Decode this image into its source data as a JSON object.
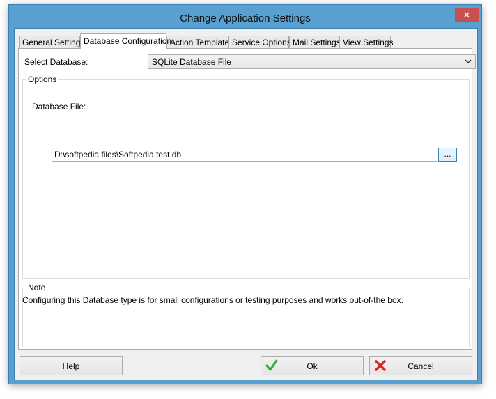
{
  "window": {
    "title": "Change Application Settings",
    "close_glyph": "✕"
  },
  "tabs": [
    {
      "label": "General Settings"
    },
    {
      "label": "Database Configuration"
    },
    {
      "label": "Action Template"
    },
    {
      "label": "Service Options"
    },
    {
      "label": "Mail Settings"
    },
    {
      "label": "View Settings"
    }
  ],
  "active_tab": "Database Configuration",
  "database": {
    "select_label": "Select Database:",
    "select_value": "SQLite Database File",
    "options_legend": "Options",
    "file_label": "Database File:",
    "file_value": "D:\\softpedia files\\Softpedia test.db",
    "browse_label": "..."
  },
  "note": {
    "legend": "Note",
    "text": "Configuring this Database type is for small configurations or testing purposes and works out-of-the box."
  },
  "buttons": {
    "help": "Help",
    "ok": "Ok",
    "cancel": "Cancel"
  },
  "icons": {
    "ok": "check-icon",
    "cancel": "cross-icon",
    "close": "close-icon",
    "dropdown": "chevron-down-icon"
  },
  "colors": {
    "title_bar": "#57a0cf",
    "close_button": "#c75050",
    "ok_check": "#3aa83a",
    "cancel_cross": "#d22a2a"
  }
}
